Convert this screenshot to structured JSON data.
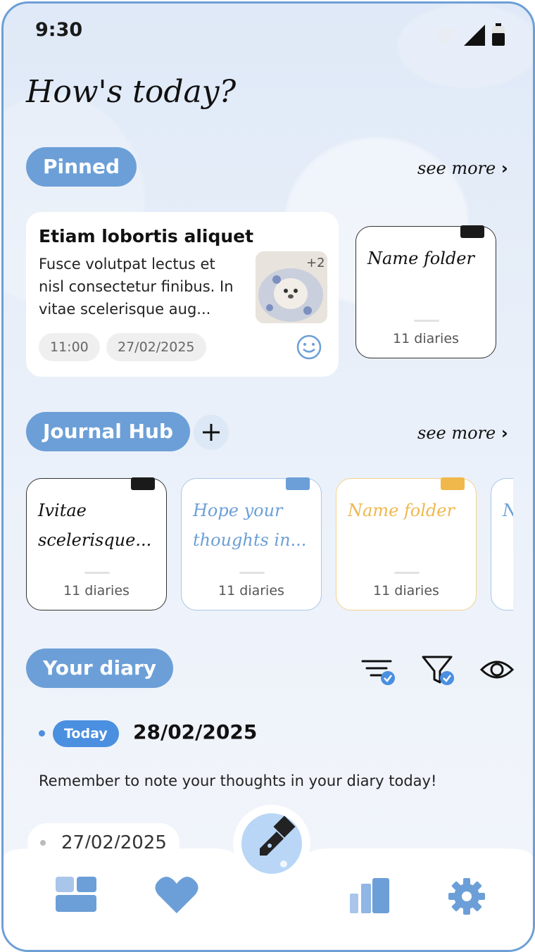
{
  "status": {
    "time": "9:30"
  },
  "header": {
    "title": "How's today?"
  },
  "pinned": {
    "label": "Pinned",
    "see_more": "see more",
    "note": {
      "title": "Etiam lobortis aliquet",
      "body": "Fusce volutpat lectus et nisl consectetur finibus. In vitae scelerisque aug...",
      "extra_photos": "+2",
      "time": "11:00",
      "date": "27/02/2025"
    },
    "folder": {
      "name": "Name folder",
      "count": "11 diaries",
      "tab_color": "#1a1a1a"
    }
  },
  "journal_hub": {
    "label": "Journal Hub",
    "see_more": "see more",
    "folders": [
      {
        "name": "Ivitae scelerisque...",
        "count": "11 diaries",
        "tab_color": "#1a1a1a",
        "text_color": "#111111",
        "border": "#333333"
      },
      {
        "name": "Hope your thoughts in...",
        "count": "11 diaries",
        "tab_color": "#6c9fd7",
        "text_color": "#6c9fd7",
        "border": "#a9c6ea"
      },
      {
        "name": "Name folder",
        "count": "11 diaries",
        "tab_color": "#f0b84a",
        "text_color": "#efb84e",
        "border": "#f3d48e"
      },
      {
        "name": "N",
        "count": "",
        "tab_color": "#6c9fd7",
        "text_color": "#6c9fd7",
        "border": "#a9c6ea"
      }
    ]
  },
  "diary": {
    "label": "Your diary",
    "today_badge": "Today",
    "today_date": "28/02/2025",
    "reminder": "Remember to note your thoughts in your diary today!",
    "previous_date": "27/02/2025"
  },
  "nav": {
    "items": [
      "grid-icon",
      "heart-icon",
      "pen-icon",
      "stats-icon",
      "settings-icon"
    ],
    "accent": "#6c9fd7"
  }
}
